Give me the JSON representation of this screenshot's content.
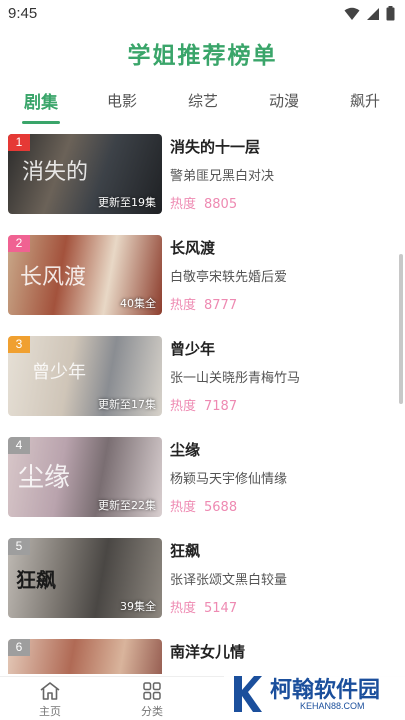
{
  "status": {
    "time": "9:45"
  },
  "page": {
    "title": "学姐推荐榜单"
  },
  "tabs": [
    {
      "label": "剧集",
      "active": true
    },
    {
      "label": "电影",
      "active": false
    },
    {
      "label": "综艺",
      "active": false
    },
    {
      "label": "动漫",
      "active": false
    },
    {
      "label": "飙升",
      "active": false
    }
  ],
  "heat_label": "热度",
  "items": [
    {
      "rank": "1",
      "title": "消失的十一层",
      "desc": "警弟匪兄黑白对决",
      "heat": "8805",
      "episodes": "更新至19集",
      "rank_color": "#e53935",
      "poster_text": "消失的"
    },
    {
      "rank": "2",
      "title": "长风渡",
      "desc": "白敬亭宋轶先婚后爱",
      "heat": "8777",
      "episodes": "40集全",
      "rank_color": "#f06292",
      "poster_text": "长风渡"
    },
    {
      "rank": "3",
      "title": "曾少年",
      "desc": "张一山关晓彤青梅竹马",
      "heat": "7187",
      "episodes": "更新至17集",
      "rank_color": "#f0a030",
      "poster_text": "曾少年"
    },
    {
      "rank": "4",
      "title": "尘缘",
      "desc": "杨颖马天宇修仙情缘",
      "heat": "5688",
      "episodes": "更新至22集",
      "rank_color": "#9e9e9e",
      "poster_text": "尘缘"
    },
    {
      "rank": "5",
      "title": "狂飙",
      "desc": "张译张颂文黑白较量",
      "heat": "5147",
      "episodes": "39集全",
      "rank_color": "#9e9e9e",
      "poster_text": "狂飙"
    },
    {
      "rank": "6",
      "title": "南洋女儿情",
      "desc": "",
      "heat": "",
      "episodes": "",
      "rank_color": "#9e9e9e",
      "poster_text": ""
    }
  ],
  "bottom_nav": [
    {
      "label": "主页",
      "icon": "home-icon"
    },
    {
      "label": "分类",
      "icon": "grid-icon"
    }
  ],
  "watermark": {
    "text": "柯翰软件园",
    "sub": "KEHAN88.COM"
  }
}
